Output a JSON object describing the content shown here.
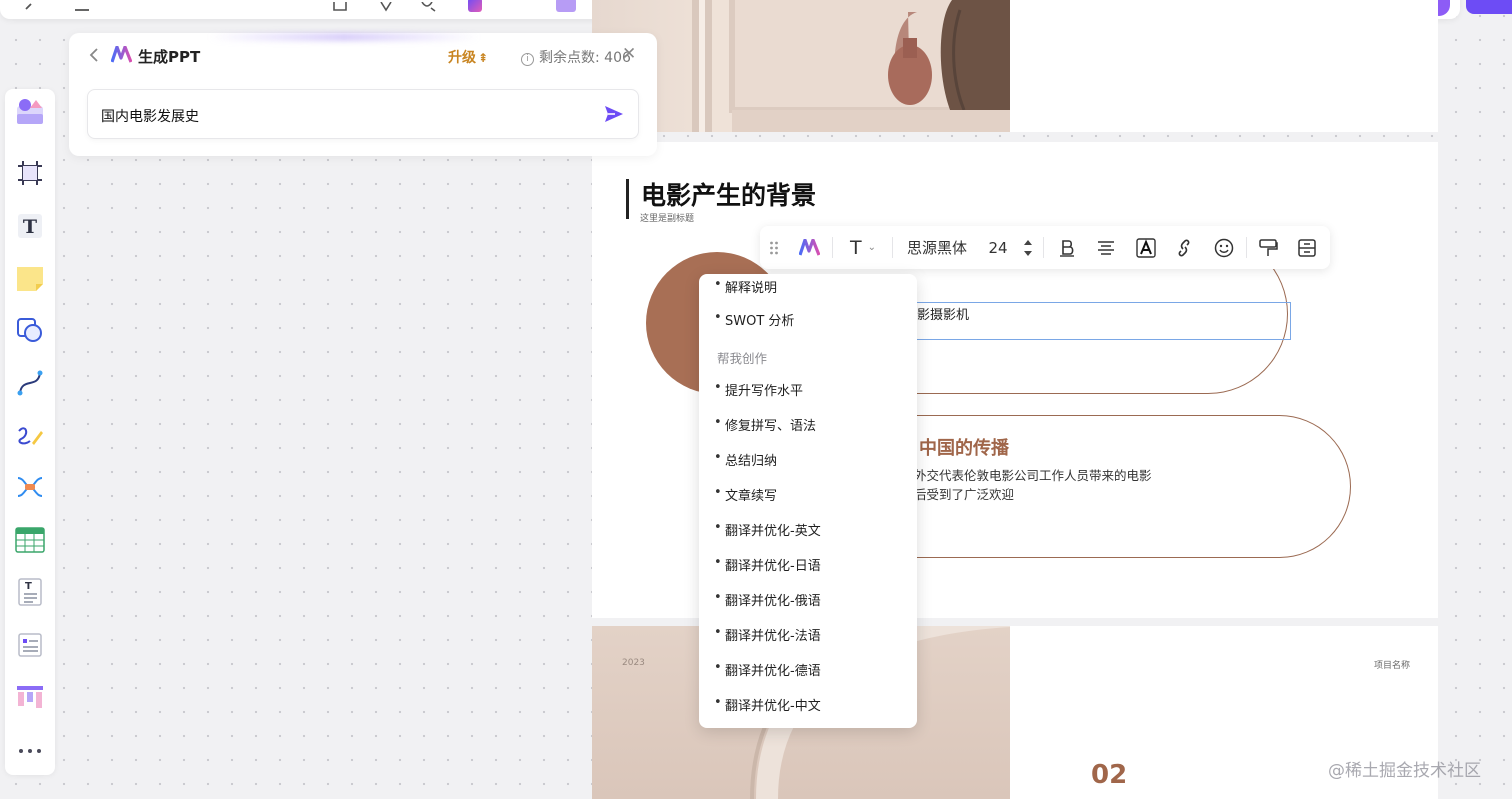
{
  "generate_panel": {
    "back_label": "<",
    "title": "生成PPT",
    "upgrade_label": "升级",
    "points_label": "剩余点数: 406",
    "close_label": "✕",
    "input_value": "国内电影发展史"
  },
  "slide2": {
    "title": "电影产生的背景",
    "subtitle": "这里是副标题",
    "item1_text": "影摄影机",
    "item2_title": "中国的传播",
    "item2_desc_line1": "外交代表伦敦电影公司工作人员带来的电影",
    "item2_desc_line2": "后受到了广泛欢迎"
  },
  "slide3": {
    "year": "2023",
    "project_label": "项目名称",
    "number": "02"
  },
  "format_toolbar": {
    "font_family": "思源黑体",
    "font_size": "24",
    "text_icon_label": "T"
  },
  "ai_menu": {
    "items_top": [
      "解释说明",
      "SWOT 分析"
    ],
    "section_label": "帮我创作",
    "items": [
      "提升写作水平",
      "修复拼写、语法",
      "总结归纳",
      "文章续写",
      "翻译并优化-英文",
      "翻译并优化-日语",
      "翻译并优化-俄语",
      "翻译并优化-法语",
      "翻译并优化-德语",
      "翻译并优化-中文"
    ]
  },
  "watermark": "@稀土掘金技术社区",
  "colors": {
    "accent": "#6d4cf5",
    "brown": "#a86f55",
    "upgrade": "#c88420"
  }
}
